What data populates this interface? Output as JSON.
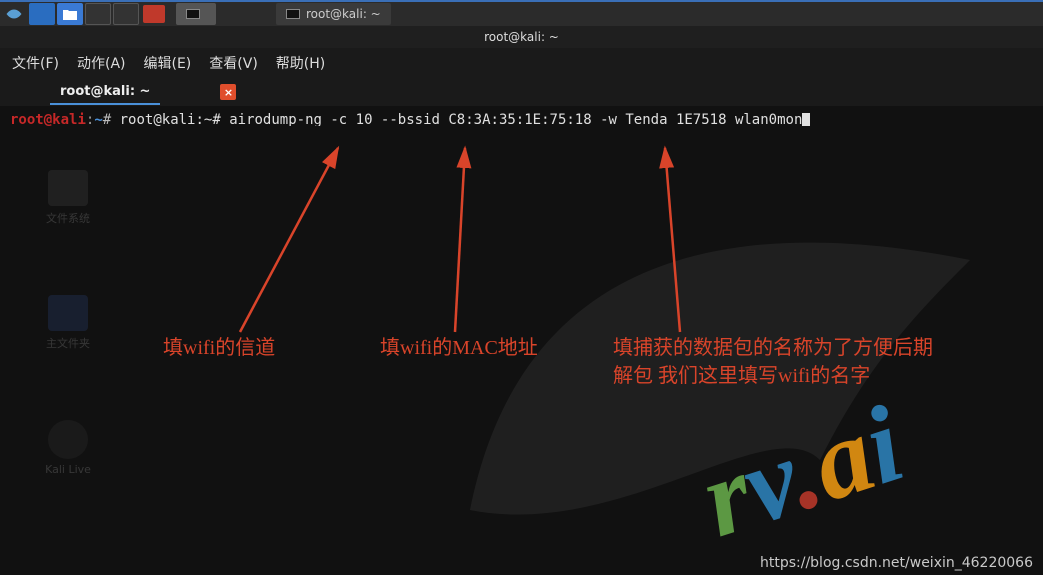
{
  "taskbar": {
    "app_active_label": "",
    "app_label": "root@kali: ~"
  },
  "titlebar": {
    "title": "root@kali: ~"
  },
  "menubar": {
    "file": "文件(F)",
    "action": "动作(A)",
    "edit": "编辑(E)",
    "view": "查看(V)",
    "help": "帮助(H)"
  },
  "tab": {
    "label": "root@kali: ~",
    "close": "×"
  },
  "terminal": {
    "prompt1_user": "root",
    "prompt1_at": "@",
    "prompt1_host": "kali",
    "prompt1_colon": ":",
    "prompt1_path": "~",
    "prompt1_hash": "#",
    "prompt2": "root@kali:~#",
    "command": "airodump-ng -c 10 --bssid C8:3A:35:1E:75:18 -w Tenda_1E7518 wlan0mon"
  },
  "desktop": {
    "icon1": "文件系统",
    "icon2": "主文件夹",
    "icon3": "Kali Live"
  },
  "annotations": {
    "channel": "填wifi的信道",
    "mac": "填wifi的MAC地址",
    "capture": "填捕获的数据包的名称为了方便后期解包 我们这里填写wifi的名字"
  },
  "watermark": {
    "r": "r",
    "v": "v",
    "dot": ".",
    "a": "a",
    "i": "i"
  },
  "source_url": "https://blog.csdn.net/weixin_46220066"
}
